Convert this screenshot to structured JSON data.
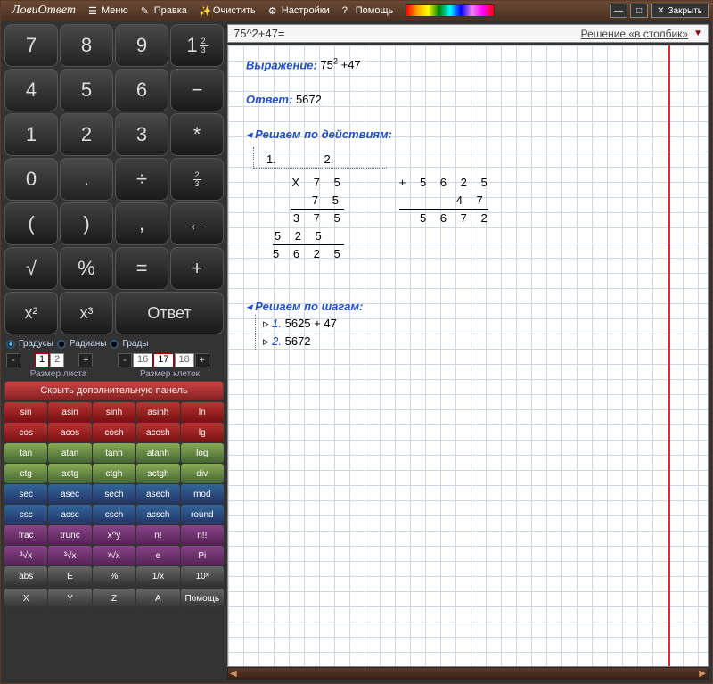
{
  "app_name": "ЛовиОтвет",
  "menu": {
    "menu": "Меню",
    "edit": "Правка",
    "clear": "Очистить",
    "settings": "Настройки",
    "help": "Помощь",
    "close": "Закрыть"
  },
  "keypad": {
    "n7": "7",
    "n8": "8",
    "n9": "9",
    "div": "÷",
    "n4": "4",
    "n5": "5",
    "n6": "6",
    "minus": "−",
    "n1": "1",
    "n2": "2",
    "n3": "3",
    "mul": "*",
    "n0": "0",
    "dot": ".",
    "pm": "÷",
    "lpar": "(",
    "rpar": ")",
    "bksp": "←",
    "sqrt": "√",
    "pct": "%",
    "eq": "=",
    "plus": "+",
    "x2": "x²",
    "x3": "x³",
    "answer": "Ответ",
    "frac_top": "2",
    "frac_bot": "3",
    "prefix": "1"
  },
  "angle": {
    "degrees": "Градусы",
    "radians": "Радианы",
    "grads": "Грады"
  },
  "size": {
    "sheet_label": "Размер листа",
    "cell_label": "Размер клеток",
    "sheet_cur": "1",
    "sheet_next": "2",
    "cell_prev": "16",
    "cell_cur": "17",
    "cell_next": "18",
    "minus": "-",
    "plus": "+"
  },
  "hide_panel": "Скрыть дополнительную панель",
  "sci": {
    "sin": "sin",
    "asin": "asin",
    "sinh": "sinh",
    "asinh": "asinh",
    "ln": "ln",
    "cos": "cos",
    "acos": "acos",
    "cosh": "cosh",
    "acosh": "acosh",
    "lg": "lg",
    "tan": "tan",
    "atan": "atan",
    "tanh": "tanh",
    "atanh": "atanh",
    "log": "log",
    "ctg": "ctg",
    "actg": "actg",
    "ctgh": "ctgh",
    "actgh": "actgh",
    "div": "div",
    "sec": "sec",
    "asec": "asec",
    "sech": "sech",
    "asech": "asech",
    "mod": "mod",
    "csc": "csc",
    "acsc": "acsc",
    "csch": "csch",
    "acsch": "acsch",
    "round": "round",
    "frac": "frac",
    "trunc": "trunc",
    "xy": "x^y",
    "n": "n!",
    "n2": "n!!",
    "cbrt": "³√x",
    "ycbrt": "³√x",
    "yroot": "ʸ√x",
    "e": "e",
    "pi": "Pi",
    "abs": "abs",
    "E": "E",
    "perc": "%",
    "inv": "1/x",
    "tenx": "10ˣ"
  },
  "bottom": {
    "X": "X",
    "Y": "Y",
    "Z": "Z",
    "A": "A",
    "help": "Помощь"
  },
  "expr": "75^2+47=",
  "solution_type": "Решение «в столбик»",
  "paper": {
    "expression_label": "Выражение:",
    "expression_val": "75² +47",
    "answer_label": "Ответ:",
    "answer_val": "5672",
    "by_actions": "Решаем по действиям:",
    "by_steps": "Решаем по шагам:",
    "step_marks": {
      "s1": "1.",
      "s2": "2."
    },
    "mult": {
      "r1": "X 7 5",
      "r2": "  7 5",
      "r3": "3 7 5",
      "r4": "5 2 5",
      "r5": "5 6 2 5"
    },
    "add": {
      "r1": "+ 5 6 2 5",
      "r2": "      4 7",
      "r3": "  5 6 7 2"
    },
    "steps": {
      "s1n": "1.",
      "s1": "5625 + 47",
      "s2n": "2.",
      "s2": "5672"
    }
  }
}
